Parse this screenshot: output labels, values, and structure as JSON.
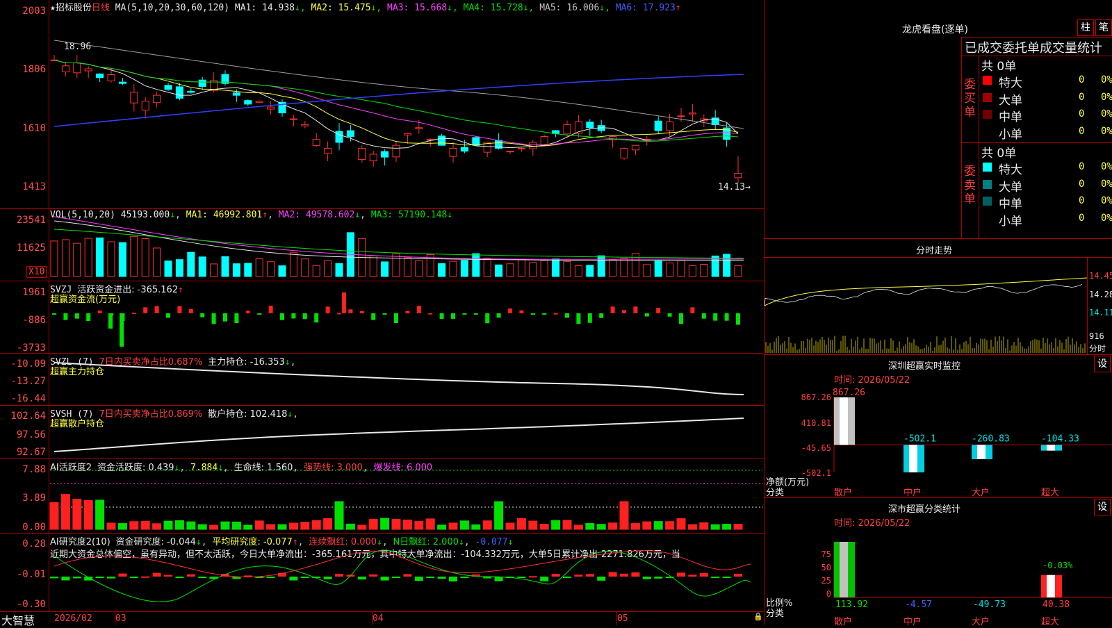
{
  "stock": {
    "star": "★",
    "name": "招标股份",
    "period": "日线",
    "ma_label": "MA(5,10,20,30,60,120)",
    "ma": [
      {
        "label": "MA1: 14.938",
        "arrow": "↓",
        "color": "#e8e8e8"
      },
      {
        "label": "MA2: 15.475",
        "arrow": "↓",
        "color": "#ffff40"
      },
      {
        "label": "MA3: 15.668",
        "arrow": "↓",
        "color": "#ff40ff"
      },
      {
        "label": "MA4: 15.728",
        "arrow": "↓",
        "color": "#00e000"
      },
      {
        "label": "MA5: 16.006",
        "arrow": "↓",
        "color": "#c0c0c0"
      },
      {
        "label": "MA6: 17.923",
        "arrow": "↑",
        "color": "#4060ff"
      }
    ],
    "high_label": "18.96",
    "low_label": "14.13→"
  },
  "main_axis": [
    "2003",
    "1806",
    "1610",
    "1413"
  ],
  "vol": {
    "label": "VOL(5,10,20)",
    "value": "45193.000",
    "ma1": "MA1: 46992.801",
    "ma2": "MA2: 49578.602",
    "ma3": "MA3: 57190.148",
    "axis": [
      "23541",
      "11625"
    ],
    "unit": "X10"
  },
  "svzj": {
    "name": "SVZJ",
    "label": "活跃资金进出: -365.162",
    "sub": "超赢资金流(万元)",
    "axis": [
      "1961",
      "-886",
      "-3733"
    ]
  },
  "svzl": {
    "name": "SVZL (7)",
    "ratio": "7日内买卖净占比0.687%",
    "label": "主力持仓: -16.353",
    "sub": "超赢主力持仓",
    "axis": [
      "-10.09",
      "-13.27",
      "-16.44"
    ]
  },
  "svsh": {
    "name": "SVSH (7)",
    "ratio": "7日内买卖净占比0.869%",
    "label": "散户持仓: 102.418",
    "sub": "超赢散户持仓",
    "axis": [
      "102.64",
      "97.56",
      "92.67"
    ]
  },
  "ai1": {
    "name": "AI活跃度2",
    "a": "资金活跃度: 0.439",
    "b": "7.884",
    "c": "生命线: 1.560",
    "d": "强势线: 3.000",
    "e": "爆发线: 6.000",
    "axis": [
      "7.88",
      "3.89",
      "0.00"
    ]
  },
  "ai2": {
    "name": "AI研究度2(10)",
    "a": "资金研究度: -0.044",
    "b": "平均研究度: -0.077",
    "c": "连续飘红: 0.000",
    "d": "N日飘红: 2.000",
    "e": "-0.077",
    "text": "近期大资金总体偏空，虽有异动，但不太活跃，今日大单净流出：-365.161万元，其中特大单净流出：-104.332万元，大单5日累计净出-2271.826万元，当",
    "axis": [
      "0.28",
      "-0.01",
      "-0.30"
    ]
  },
  "xaxis": {
    "brand": "大智慧",
    "labels": [
      "2026/02",
      "03",
      "04",
      "05"
    ]
  },
  "longhu": {
    "title": "龙虎看盘(逐单)",
    "btn1": "柱",
    "btn2": "笔",
    "subtitle": "已成交委托单成交量统计",
    "buy_side": "委买单",
    "sell_side": "委卖单",
    "buy_total": "共 0单",
    "sell_total": "共 0单",
    "rows_buy": [
      {
        "name": "特大",
        "val": "0",
        "pct": "0%",
        "color": "#ff0000"
      },
      {
        "name": "大单",
        "val": "0",
        "pct": "0%",
        "color": "#a00000"
      },
      {
        "name": "中单",
        "val": "0",
        "pct": "0%",
        "color": "#700000"
      },
      {
        "name": "小单",
        "val": "0",
        "pct": "0%",
        "color": ""
      }
    ],
    "rows_sell": [
      {
        "name": "特大",
        "val": "0",
        "pct": "0%",
        "color": "#00ffff"
      },
      {
        "name": "大单",
        "val": "0",
        "pct": "0%",
        "color": "#008080"
      },
      {
        "name": "中单",
        "val": "0",
        "pct": "0%",
        "color": "#006060"
      },
      {
        "name": "小单",
        "val": "0",
        "pct": "0%",
        "color": ""
      }
    ]
  },
  "intraday": {
    "title": "分时走势",
    "axis": [
      "14.45",
      "14.28",
      "14.11"
    ],
    "vol": "916",
    "unit": "分时"
  },
  "monitor": {
    "title": "深圳超赢实时监控",
    "btn": "设",
    "time": "时间: 2026/05/22",
    "axis": [
      "867.26",
      "410.81",
      "-45.65",
      "-502.1"
    ],
    "ylabel": "净额(万元)",
    "xlabel": "分类",
    "bars": [
      {
        "cat": "散户",
        "val": 867.26,
        "label": "867.26"
      },
      {
        "cat": "中户",
        "val": -502.1,
        "label": "-502.1"
      },
      {
        "cat": "大户",
        "val": -260.83,
        "label": "-260.83"
      },
      {
        "cat": "超大",
        "val": -104.33,
        "label": "-104.33"
      }
    ]
  },
  "classify": {
    "title": "深市超赢分类统计",
    "btn": "设",
    "time": "时间: 2026/05/22",
    "axis": [
      "75",
      "50",
      "25",
      "0"
    ],
    "ylabel": "比例%",
    "xlabel": "分类",
    "top_label": "-0.03%",
    "bars": [
      {
        "cat": "散户",
        "val": 113.92,
        "label": "113.92"
      },
      {
        "cat": "中户",
        "val": -4.57,
        "label": "-4.57"
      },
      {
        "cat": "大户",
        "val": -49.73,
        "label": "-49.73"
      },
      {
        "cat": "超大",
        "val": 40.38,
        "label": "40.38"
      }
    ]
  },
  "chart_data": {
    "type": "bar",
    "title": "深圳超赢实时监控",
    "categories": [
      "散户",
      "中户",
      "大户",
      "超大"
    ],
    "series": [
      {
        "values": [
          867.26,
          -502.1,
          -260.83,
          -104.33
        ]
      }
    ],
    "ylabel": "净额(万元)",
    "ylim": [
      -502.1,
      867.26
    ]
  }
}
